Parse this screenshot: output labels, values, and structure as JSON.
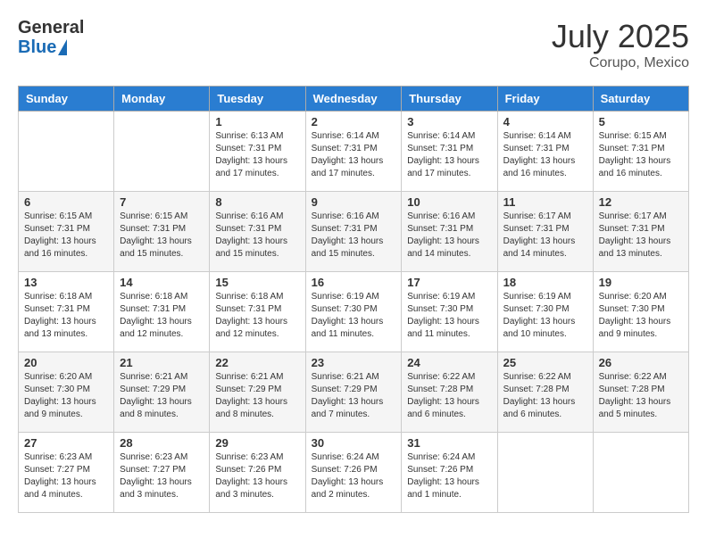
{
  "header": {
    "logo": {
      "general": "General",
      "blue": "Blue"
    },
    "title": "July 2025",
    "location": "Corupo, Mexico"
  },
  "calendar": {
    "days_of_week": [
      "Sunday",
      "Monday",
      "Tuesday",
      "Wednesday",
      "Thursday",
      "Friday",
      "Saturday"
    ],
    "weeks": [
      [
        {
          "day": "",
          "info": ""
        },
        {
          "day": "",
          "info": ""
        },
        {
          "day": "1",
          "info": "Sunrise: 6:13 AM\nSunset: 7:31 PM\nDaylight: 13 hours and 17 minutes."
        },
        {
          "day": "2",
          "info": "Sunrise: 6:14 AM\nSunset: 7:31 PM\nDaylight: 13 hours and 17 minutes."
        },
        {
          "day": "3",
          "info": "Sunrise: 6:14 AM\nSunset: 7:31 PM\nDaylight: 13 hours and 17 minutes."
        },
        {
          "day": "4",
          "info": "Sunrise: 6:14 AM\nSunset: 7:31 PM\nDaylight: 13 hours and 16 minutes."
        },
        {
          "day": "5",
          "info": "Sunrise: 6:15 AM\nSunset: 7:31 PM\nDaylight: 13 hours and 16 minutes."
        }
      ],
      [
        {
          "day": "6",
          "info": "Sunrise: 6:15 AM\nSunset: 7:31 PM\nDaylight: 13 hours and 16 minutes."
        },
        {
          "day": "7",
          "info": "Sunrise: 6:15 AM\nSunset: 7:31 PM\nDaylight: 13 hours and 15 minutes."
        },
        {
          "day": "8",
          "info": "Sunrise: 6:16 AM\nSunset: 7:31 PM\nDaylight: 13 hours and 15 minutes."
        },
        {
          "day": "9",
          "info": "Sunrise: 6:16 AM\nSunset: 7:31 PM\nDaylight: 13 hours and 15 minutes."
        },
        {
          "day": "10",
          "info": "Sunrise: 6:16 AM\nSunset: 7:31 PM\nDaylight: 13 hours and 14 minutes."
        },
        {
          "day": "11",
          "info": "Sunrise: 6:17 AM\nSunset: 7:31 PM\nDaylight: 13 hours and 14 minutes."
        },
        {
          "day": "12",
          "info": "Sunrise: 6:17 AM\nSunset: 7:31 PM\nDaylight: 13 hours and 13 minutes."
        }
      ],
      [
        {
          "day": "13",
          "info": "Sunrise: 6:18 AM\nSunset: 7:31 PM\nDaylight: 13 hours and 13 minutes."
        },
        {
          "day": "14",
          "info": "Sunrise: 6:18 AM\nSunset: 7:31 PM\nDaylight: 13 hours and 12 minutes."
        },
        {
          "day": "15",
          "info": "Sunrise: 6:18 AM\nSunset: 7:31 PM\nDaylight: 13 hours and 12 minutes."
        },
        {
          "day": "16",
          "info": "Sunrise: 6:19 AM\nSunset: 7:30 PM\nDaylight: 13 hours and 11 minutes."
        },
        {
          "day": "17",
          "info": "Sunrise: 6:19 AM\nSunset: 7:30 PM\nDaylight: 13 hours and 11 minutes."
        },
        {
          "day": "18",
          "info": "Sunrise: 6:19 AM\nSunset: 7:30 PM\nDaylight: 13 hours and 10 minutes."
        },
        {
          "day": "19",
          "info": "Sunrise: 6:20 AM\nSunset: 7:30 PM\nDaylight: 13 hours and 9 minutes."
        }
      ],
      [
        {
          "day": "20",
          "info": "Sunrise: 6:20 AM\nSunset: 7:30 PM\nDaylight: 13 hours and 9 minutes."
        },
        {
          "day": "21",
          "info": "Sunrise: 6:21 AM\nSunset: 7:29 PM\nDaylight: 13 hours and 8 minutes."
        },
        {
          "day": "22",
          "info": "Sunrise: 6:21 AM\nSunset: 7:29 PM\nDaylight: 13 hours and 8 minutes."
        },
        {
          "day": "23",
          "info": "Sunrise: 6:21 AM\nSunset: 7:29 PM\nDaylight: 13 hours and 7 minutes."
        },
        {
          "day": "24",
          "info": "Sunrise: 6:22 AM\nSunset: 7:28 PM\nDaylight: 13 hours and 6 minutes."
        },
        {
          "day": "25",
          "info": "Sunrise: 6:22 AM\nSunset: 7:28 PM\nDaylight: 13 hours and 6 minutes."
        },
        {
          "day": "26",
          "info": "Sunrise: 6:22 AM\nSunset: 7:28 PM\nDaylight: 13 hours and 5 minutes."
        }
      ],
      [
        {
          "day": "27",
          "info": "Sunrise: 6:23 AM\nSunset: 7:27 PM\nDaylight: 13 hours and 4 minutes."
        },
        {
          "day": "28",
          "info": "Sunrise: 6:23 AM\nSunset: 7:27 PM\nDaylight: 13 hours and 3 minutes."
        },
        {
          "day": "29",
          "info": "Sunrise: 6:23 AM\nSunset: 7:26 PM\nDaylight: 13 hours and 3 minutes."
        },
        {
          "day": "30",
          "info": "Sunrise: 6:24 AM\nSunset: 7:26 PM\nDaylight: 13 hours and 2 minutes."
        },
        {
          "day": "31",
          "info": "Sunrise: 6:24 AM\nSunset: 7:26 PM\nDaylight: 13 hours and 1 minute."
        },
        {
          "day": "",
          "info": ""
        },
        {
          "day": "",
          "info": ""
        }
      ]
    ]
  }
}
